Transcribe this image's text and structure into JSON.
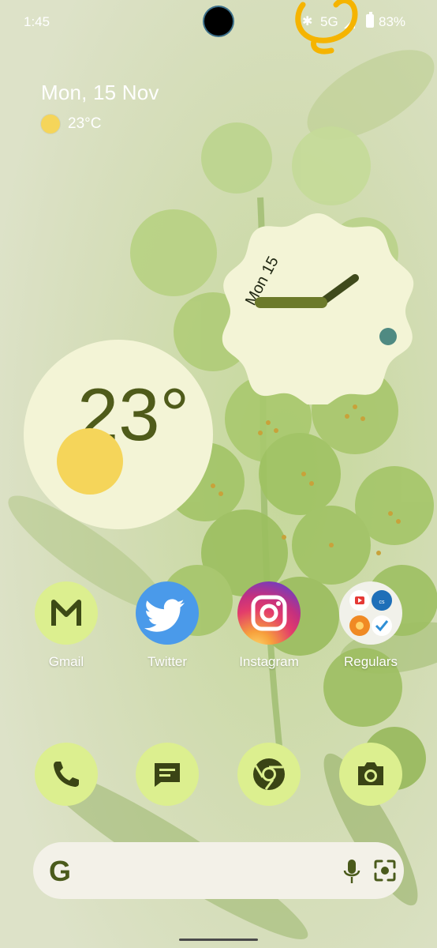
{
  "status_bar": {
    "time": "1:45",
    "network": "5G",
    "battery": "83%"
  },
  "glance": {
    "date": "Mon, 15 Nov",
    "temperature": "23°C"
  },
  "clock_widget": {
    "date_label": "Mon 15"
  },
  "weather_widget": {
    "temperature": "23°"
  },
  "apps": [
    {
      "label": "Gmail",
      "icon": "gmail-icon"
    },
    {
      "label": "Twitter",
      "icon": "twitter-bird-icon"
    },
    {
      "label": "Instagram",
      "icon": "instagram-icon"
    },
    {
      "label": "Regulars",
      "icon": "folder-icon"
    }
  ],
  "dock": [
    {
      "icon": "phone-icon"
    },
    {
      "icon": "messages-icon"
    },
    {
      "icon": "chrome-icon"
    },
    {
      "icon": "camera-icon"
    }
  ],
  "search_bar": {
    "logo": "G"
  },
  "colors": {
    "accent_dark": "#4f5b1a",
    "accent_light": "#dcef8f",
    "widget_bg": "#f3f4d6",
    "sun": "#f5d55a",
    "annotation": "#f5b400"
  }
}
